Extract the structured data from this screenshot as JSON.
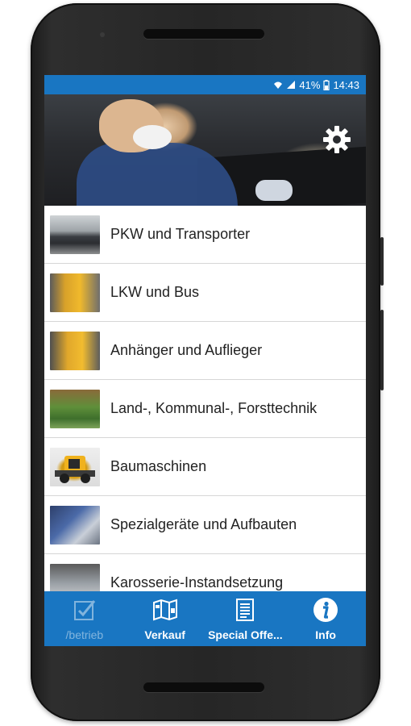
{
  "statusbar": {
    "battery": "41%",
    "time": "14:43"
  },
  "hero": {
    "settings_icon": "gear-icon"
  },
  "categories": [
    {
      "label": "PKW und Transporter",
      "icon": "car-thumbnail"
    },
    {
      "label": "LKW und Bus",
      "icon": "truck-thumbnail"
    },
    {
      "label": "Anhänger und Auflieger",
      "icon": "trailer-thumbnail"
    },
    {
      "label": "Land-, Kommunal-, Forsttechnik",
      "icon": "tractor-thumbnail"
    },
    {
      "label": "Baumaschinen",
      "icon": "skid-loader-thumbnail"
    },
    {
      "label": "Spezialgeräte und Aufbauten",
      "icon": "special-equipment-thumbnail"
    },
    {
      "label": "Karosserie-Instandsetzung",
      "icon": "bodywork-thumbnail"
    }
  ],
  "bottom_nav": [
    {
      "label": "/betrieb",
      "icon": "checkbox-icon"
    },
    {
      "label": "Verkauf",
      "icon": "map-icon"
    },
    {
      "label": "Special Offe...",
      "icon": "document-icon"
    },
    {
      "label": "Info",
      "icon": "info-icon"
    }
  ],
  "colors": {
    "primary": "#1976c2",
    "divider": "#d6d6d6"
  }
}
